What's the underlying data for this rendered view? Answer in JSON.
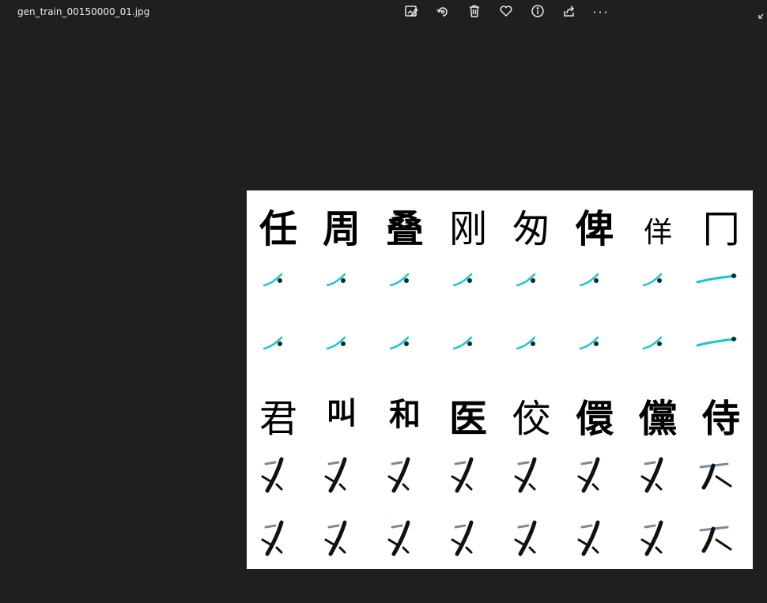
{
  "window": {
    "title": "gen_train_00150000_01.jpg"
  },
  "toolbar": {
    "buttons": [
      {
        "name": "edit-image-icon"
      },
      {
        "name": "rotate-icon"
      },
      {
        "name": "delete-icon"
      },
      {
        "name": "favorite-icon"
      },
      {
        "name": "info-icon"
      },
      {
        "name": "share-icon"
      }
    ],
    "more_label": "···"
  },
  "image": {
    "top_characters": [
      "任",
      "周",
      "叠",
      "刚",
      "匆",
      "俾",
      "佯",
      "冂"
    ],
    "bottom_characters": [
      "君",
      "叫",
      "和",
      "医",
      "佼",
      "儇",
      "儻",
      "侍"
    ],
    "colors": {
      "cyan_stroke": "#18c8c8",
      "dark_stroke": "#111111",
      "background": "#ffffff"
    }
  }
}
